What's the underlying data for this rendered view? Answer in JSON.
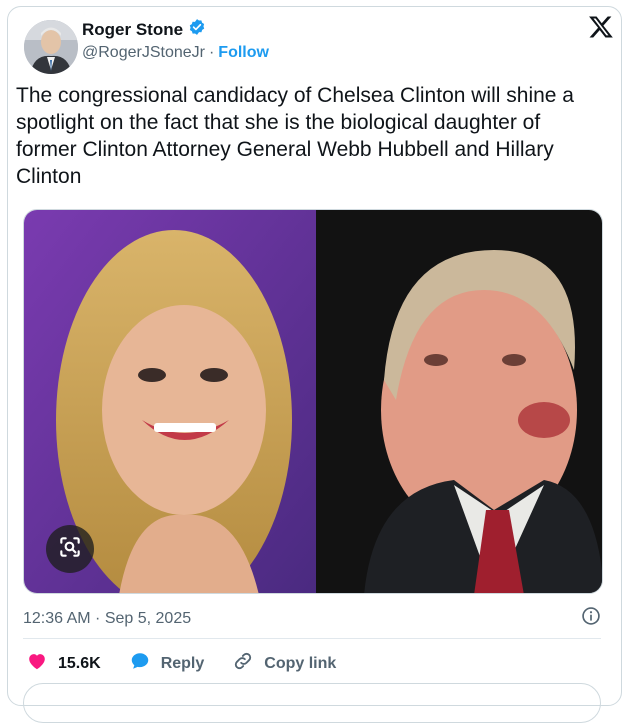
{
  "author": {
    "display_name": "Roger Stone",
    "handle": "@RogerJStoneJr",
    "separator": "·",
    "follow_label": "Follow"
  },
  "tweet": {
    "text": "The congressional candidacy of Chelsea Clinton will shine a spotlight on the fact that she is the biological daughter of former Clinton Attorney General Webb Hubbell and Hillary Clinton"
  },
  "meta": {
    "timestamp": "12:36 AM · Sep 5, 2025"
  },
  "actions": {
    "likes_count": "15.6K",
    "reply_label": "Reply",
    "copy_link_label": "Copy link"
  },
  "colors": {
    "brand_blue": "#1d9bf0",
    "like_pink": "#f91880",
    "text_primary": "#0f1419",
    "text_secondary": "#536471"
  },
  "icons": [
    "verified-badge-icon",
    "x-logo-icon",
    "image-search-icon",
    "info-icon",
    "heart-icon",
    "reply-bubble-icon",
    "link-icon"
  ]
}
